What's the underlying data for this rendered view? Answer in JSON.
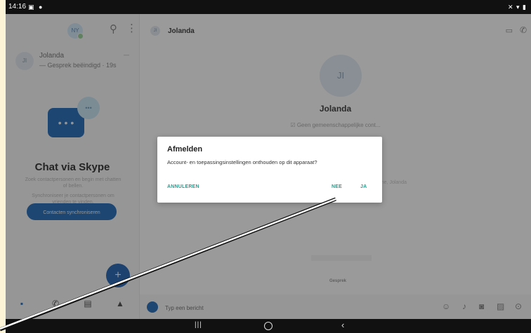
{
  "status_bar": {
    "time": "14:16",
    "left_icons": "▣ ●",
    "right_icons": "✕ ▾ ▮"
  },
  "left_pane": {
    "my_avatar_initials": "NY",
    "recent_chat": {
      "avatar_initials": "JI",
      "name": "Jolanda",
      "meta": "— Gesprek beëindigd · 19s",
      "time": "—"
    },
    "promo": {
      "title": "Chat via Skype",
      "text_1": "Zoek contactpersonen en begin met chatten of bellen.",
      "text_2": "Synchroniseer je contactpersonen om vrienden te vinden.",
      "sync_button": "Contacten synchroniseren"
    },
    "fab_label": "+",
    "bottom_nav": [
      {
        "key": "chats",
        "icon": "▪",
        "label": ""
      },
      {
        "key": "calls",
        "icon": "✆",
        "label": ""
      },
      {
        "key": "contacts",
        "icon": "▤",
        "label": ""
      },
      {
        "key": "alerts",
        "icon": "▲",
        "label": ""
      }
    ]
  },
  "right_pane": {
    "header": {
      "avatar_initials": "JI",
      "name": "Jolanda",
      "video_icon": "▭",
      "call_icon": "✆"
    },
    "profile": {
      "initials": "JI",
      "name": "Jolanda",
      "subtitle": "☑ Geen gemeenschappelijke cont..."
    },
    "bg_text": "gone, Jolanda",
    "bg_chip_label": "Gesprek",
    "compose": {
      "placeholder": "Typ een bericht"
    },
    "tools": {
      "emoji": "☺",
      "mic": "♪",
      "camera": "◙",
      "image": "▨",
      "location": "⊙"
    }
  },
  "dialog": {
    "title": "Afmelden",
    "message": "Account- en toepassingsinstellingen onthouden op dit apparaat?",
    "cancel": "ANNULEREN",
    "no": "NEE",
    "yes": "JA"
  },
  "system_nav": {
    "recent": "|||",
    "back": "‹"
  },
  "colors": {
    "accent": "#2f72b8",
    "dialog_button": "#2a9d8f",
    "scrim": "rgba(0,0,0,0.38)"
  }
}
